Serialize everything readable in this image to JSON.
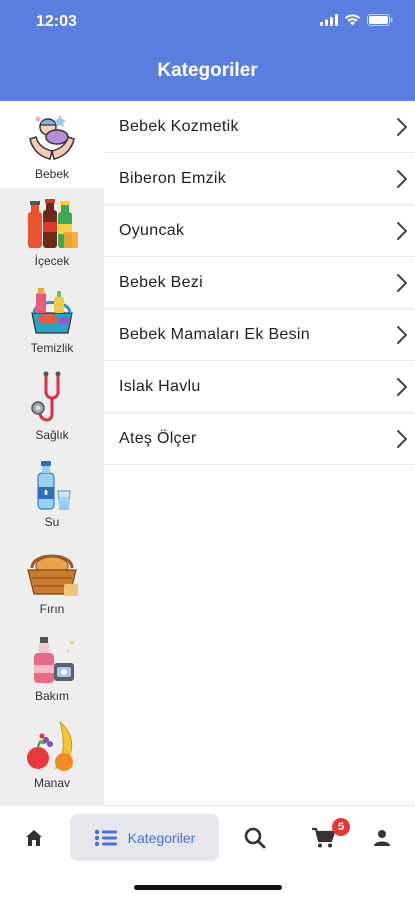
{
  "status_bar": {
    "time": "12:03"
  },
  "header": {
    "title": "Kategoriler"
  },
  "sidebar": {
    "items": [
      {
        "label": "Bebek",
        "icon": "baby-icon",
        "active": true
      },
      {
        "label": "İçecek",
        "icon": "drinks-icon",
        "active": false
      },
      {
        "label": "Temizlik",
        "icon": "cleaning-icon",
        "active": false
      },
      {
        "label": "Sağlık",
        "icon": "stethoscope-icon",
        "active": false
      },
      {
        "label": "Su",
        "icon": "water-bottle-icon",
        "active": false
      },
      {
        "label": "Fırın",
        "icon": "bread-basket-icon",
        "active": false
      },
      {
        "label": "Bakım",
        "icon": "cosmetics-icon",
        "active": false
      },
      {
        "label": "Manav",
        "icon": "fruit-icon",
        "active": false
      }
    ]
  },
  "subcategories": [
    {
      "label": "Bebek Kozmetik"
    },
    {
      "label": "Biberon Emzik"
    },
    {
      "label": "Oyuncak"
    },
    {
      "label": "Bebek Bezi"
    },
    {
      "label": "Bebek Mamaları Ek Besin"
    },
    {
      "label": "Islak Havlu"
    },
    {
      "label": "Ateş Ölçer"
    }
  ],
  "tabbar": {
    "home": {
      "icon": "home-icon"
    },
    "categories": {
      "icon": "list-icon",
      "label": "Kategoriler",
      "active": true
    },
    "search": {
      "icon": "search-icon"
    },
    "cart": {
      "icon": "cart-icon",
      "badge": "5"
    },
    "profile": {
      "icon": "user-icon"
    }
  },
  "colors": {
    "accent": "#5a7fe0",
    "badge": "#e53935",
    "sidebar_bg": "#eeeeee"
  }
}
